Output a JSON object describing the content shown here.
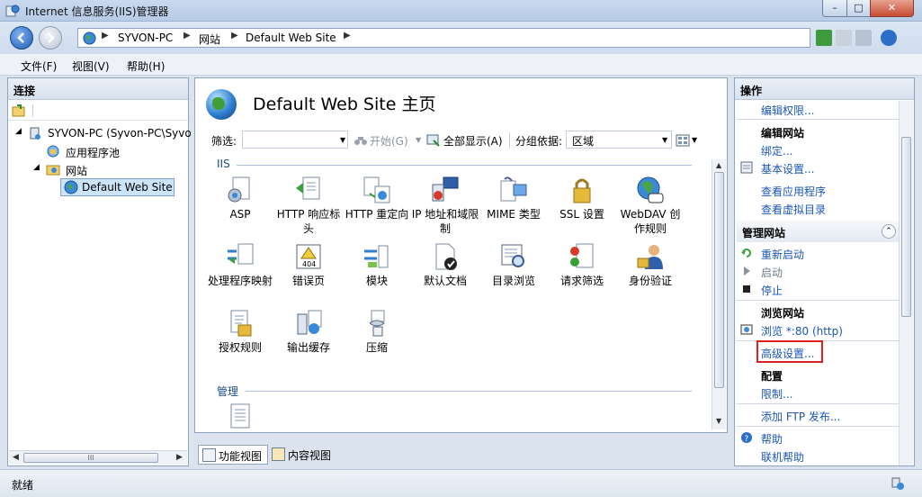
{
  "window": {
    "title": "Internet 信息服务(IIS)管理器",
    "min_label": "–",
    "max_label": "□",
    "close_label": "✕"
  },
  "address": {
    "crumbs": [
      "SYVON-PC",
      "网站",
      "Default Web Site"
    ]
  },
  "menu": {
    "items": [
      "文件(F)",
      "视图(V)",
      "帮助(H)"
    ]
  },
  "connections": {
    "title": "连接",
    "tree": [
      {
        "label": "SYVON-PC (Syvon-PC\\Syvo",
        "icon": "server-icon"
      },
      {
        "label": "应用程序池",
        "icon": "app-pool-icon"
      },
      {
        "label": "网站",
        "icon": "sites-folder-icon"
      },
      {
        "label": "Default Web Site",
        "icon": "globe-icon",
        "selected": true
      }
    ],
    "scroll_label": "III"
  },
  "center": {
    "title": "Default Web Site 主页",
    "filter_label": "筛选:",
    "start_label": "开始(G)",
    "show_all_label": "全部显示(A)",
    "group_by_label": "分组依据:",
    "group_by_value": "区域",
    "groups": [
      {
        "name": "IIS",
        "features": [
          {
            "label": "ASP",
            "icon": "asp-icon"
          },
          {
            "label": "HTTP 响应标头",
            "icon": "http-headers-icon"
          },
          {
            "label": "HTTP 重定向",
            "icon": "http-redirect-icon"
          },
          {
            "label": "IP 地址和域限制",
            "icon": "ip-restrictions-icon"
          },
          {
            "label": "MIME 类型",
            "icon": "mime-types-icon"
          },
          {
            "label": "SSL 设置",
            "icon": "ssl-lock-icon"
          },
          {
            "label": "WebDAV 创作规则",
            "icon": "webdav-icon"
          },
          {
            "label": "处理程序映射",
            "icon": "handler-mappings-icon"
          },
          {
            "label": "错误页",
            "icon": "error-pages-icon"
          },
          {
            "label": "模块",
            "icon": "modules-icon"
          },
          {
            "label": "默认文档",
            "icon": "default-document-icon"
          },
          {
            "label": "目录浏览",
            "icon": "directory-browsing-icon"
          },
          {
            "label": "请求筛选",
            "icon": "request-filtering-icon"
          },
          {
            "label": "身份验证",
            "icon": "authentication-icon"
          },
          {
            "label": "授权规则",
            "icon": "authorization-rules-icon"
          },
          {
            "label": "输出缓存",
            "icon": "output-caching-icon"
          },
          {
            "label": "压缩",
            "icon": "compression-icon"
          }
        ]
      },
      {
        "name": "管理",
        "features": [
          {
            "label": "",
            "icon": "configuration-editor-icon"
          }
        ]
      }
    ],
    "view_tabs": [
      "功能视图",
      "内容视图"
    ]
  },
  "actions": {
    "title": "操作",
    "edit_permissions": "编辑权限...",
    "edit_site_header": "编辑网站",
    "bindings": "绑定...",
    "basic_settings": "基本设置...",
    "view_apps": "查看应用程序",
    "view_vdirs": "查看虚拟目录",
    "manage_site_header": "管理网站",
    "restart": "重新启动",
    "start": "启动",
    "stop": "停止",
    "browse_site_header": "浏览网站",
    "browse_http": "浏览 *:80 (http)",
    "advanced_settings": "高级设置...",
    "config_header": "配置",
    "limits": "限制...",
    "add_ftp": "添加 FTP 发布...",
    "help": "帮助",
    "online_help": "联机帮助"
  },
  "status": {
    "text": "就绪"
  },
  "colors": {
    "link": "#1a56b8",
    "highlight_border": "#e02020",
    "selection": "#cce4f7"
  }
}
